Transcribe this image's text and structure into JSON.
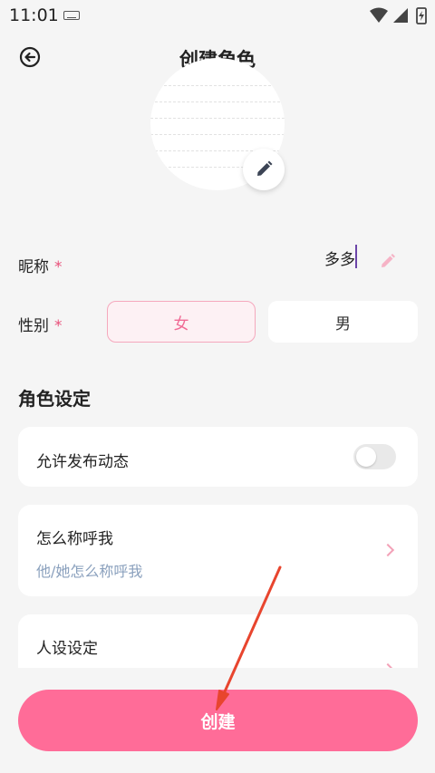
{
  "status_bar": {
    "time": "11:01"
  },
  "header": {
    "title": "创建角色",
    "back_icon": "back-circle-arrow-icon"
  },
  "avatar": {
    "edit_icon": "pencil-icon"
  },
  "form": {
    "nickname": {
      "label": "昵称",
      "required_mark": "*",
      "value": "多多"
    },
    "gender": {
      "label": "性别",
      "required_mark": "*",
      "options": [
        "女",
        "男"
      ],
      "selected": "女"
    }
  },
  "role_settings": {
    "title": "角色设定",
    "allow_post": {
      "label": "允许发布动态",
      "enabled": false
    },
    "call_me": {
      "label": "怎么称呼我",
      "placeholder": "他/她怎么称呼我"
    },
    "persona": {
      "label": "人设设定"
    }
  },
  "create_button": {
    "label": "创建"
  },
  "colors": {
    "accent": "#ff6c98",
    "selected_bg": "#fdf1f4",
    "hint": "#8aa0bd",
    "annotation_arrow": "#e8452e"
  }
}
